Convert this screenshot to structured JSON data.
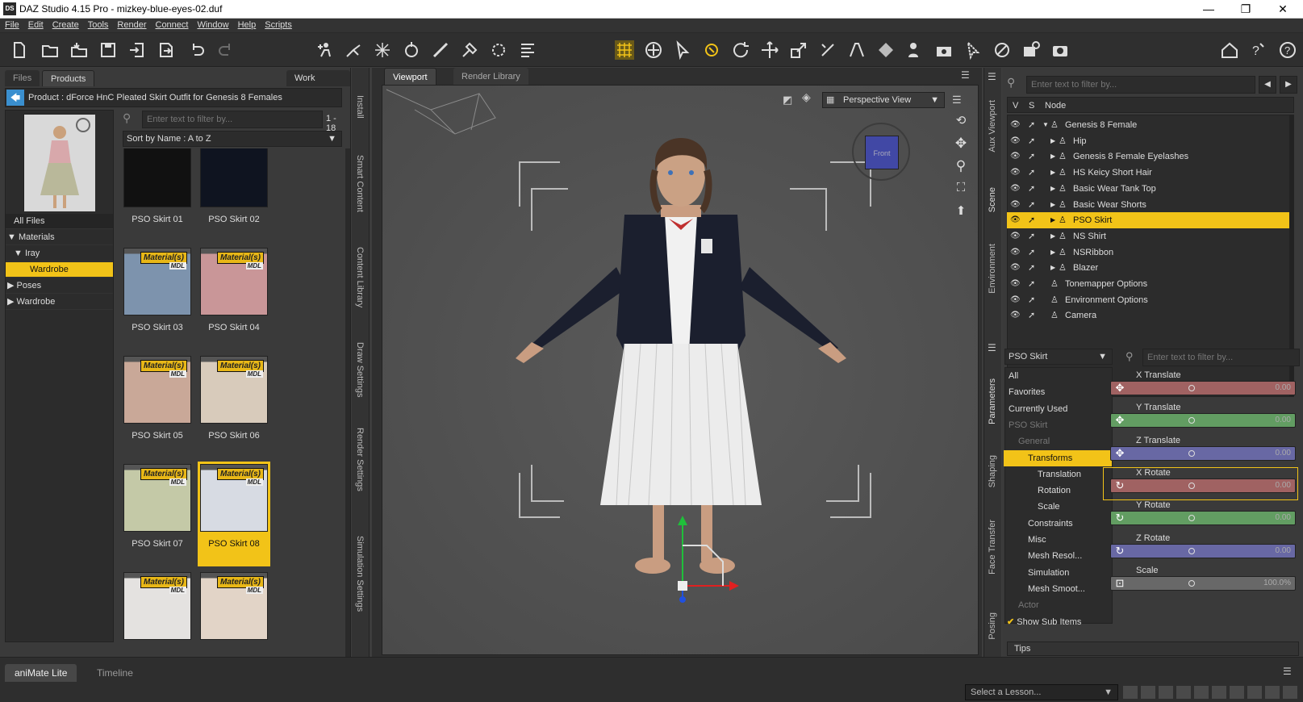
{
  "window": {
    "title": "DAZ Studio 4.15 Pro - mizkey-blue-eyes-02.duf",
    "logo": "DS",
    "controls": [
      "—",
      "❐",
      "✕"
    ]
  },
  "menu": [
    "File",
    "Edit",
    "Create",
    "Tools",
    "Render",
    "Connect",
    "Window",
    "Help",
    "Scripts"
  ],
  "left": {
    "tabs": {
      "files": "Files",
      "products": "Products",
      "work_offline": "Work Offline"
    },
    "breadcrumb": "Product : dForce HnC Pleated Skirt Outfit for Genesis 8 Females",
    "tree": {
      "all_files": "All Files",
      "materials": "Materials",
      "iray": "Iray",
      "wardrobe_sel": "Wardrobe",
      "poses": "Poses",
      "wardrobe": "Wardrobe"
    },
    "filter_placeholder": "Enter text to filter by...",
    "count": "1 - 18",
    "sort": "Sort by Name : A to Z",
    "badge": "Material(s)",
    "mdl": "MDL",
    "items": [
      {
        "label": "PSO Skirt 01",
        "color": "#111111"
      },
      {
        "label": "PSO Skirt 02",
        "color": "#0f1420"
      },
      {
        "label": "PSO Skirt 03",
        "color": "#7d93ad"
      },
      {
        "label": "PSO Skirt 04",
        "color": "#c99698"
      },
      {
        "label": "PSO Skirt 05",
        "color": "#c9a898"
      },
      {
        "label": "PSO Skirt 06",
        "color": "#d8cbbb"
      },
      {
        "label": "PSO Skirt 07",
        "color": "#c4c9a7"
      },
      {
        "label": "PSO Skirt 08",
        "color": "#d7dbe3"
      },
      {
        "label": "",
        "color": "#e4e2e0"
      },
      {
        "label": "",
        "color": "#e2d4c7"
      }
    ],
    "side_tabs": [
      "Install",
      "Smart Content",
      "Content Library",
      "Draw Settings",
      "Render Settings",
      "Simulation Settings"
    ]
  },
  "viewport": {
    "tabs": {
      "viewport": "Viewport",
      "render_library": "Render Library"
    },
    "view": "Perspective View",
    "cube": "Front"
  },
  "scene": {
    "filter_placeholder": "Enter text to filter by...",
    "headers": {
      "v": "V",
      "s": "S",
      "node": "Node"
    },
    "nodes": [
      {
        "label": "Genesis 8 Female",
        "indent": 0,
        "expander": "▼"
      },
      {
        "label": "Hip",
        "indent": 1,
        "expander": "▶"
      },
      {
        "label": "Genesis 8 Female Eyelashes",
        "indent": 1,
        "expander": "▶"
      },
      {
        "label": "HS Keicy Short Hair",
        "indent": 1,
        "expander": "▶"
      },
      {
        "label": "Basic Wear Tank Top",
        "indent": 1,
        "expander": "▶"
      },
      {
        "label": "Basic Wear Shorts",
        "indent": 1,
        "expander": "▶"
      },
      {
        "label": "PSO Skirt",
        "indent": 1,
        "expander": "▶",
        "selected": true
      },
      {
        "label": "NS Shirt",
        "indent": 1,
        "expander": "▶"
      },
      {
        "label": "NSRibbon",
        "indent": 1,
        "expander": "▶"
      },
      {
        "label": "Blazer",
        "indent": 1,
        "expander": "▶"
      },
      {
        "label": "Tonemapper Options",
        "indent": 0,
        "expander": ""
      },
      {
        "label": "Environment Options",
        "indent": 0,
        "expander": ""
      },
      {
        "label": "Camera",
        "indent": 0,
        "expander": ""
      }
    ],
    "side_tabs": [
      "Aux Viewport",
      "Scene",
      "Environment"
    ]
  },
  "params": {
    "node_select": "PSO Skirt",
    "filter_placeholder": "Enter text to filter by...",
    "categories": [
      {
        "label": "All",
        "indent": 0
      },
      {
        "label": "Favorites",
        "indent": 0
      },
      {
        "label": "Currently Used",
        "indent": 0
      },
      {
        "label": "PSO Skirt",
        "indent": 0,
        "dim": true
      },
      {
        "label": "General",
        "indent": 1,
        "dim": true
      },
      {
        "label": "Transforms",
        "indent": 2,
        "selected": true
      },
      {
        "label": "Translation",
        "indent": 3
      },
      {
        "label": "Rotation",
        "indent": 3
      },
      {
        "label": "Scale",
        "indent": 3
      },
      {
        "label": "Constraints",
        "indent": 2
      },
      {
        "label": "Misc",
        "indent": 2
      },
      {
        "label": "Mesh Resol...",
        "indent": 2
      },
      {
        "label": "Simulation",
        "indent": 2
      },
      {
        "label": "Mesh Smoot...",
        "indent": 2
      },
      {
        "label": "Actor",
        "indent": 1,
        "dim": true
      }
    ],
    "show_sub_items": "Show Sub Items",
    "sliders": [
      {
        "name": "X Translate",
        "value": "0.00",
        "color": "#a06262"
      },
      {
        "name": "Y Translate",
        "value": "0.00",
        "color": "#629d62"
      },
      {
        "name": "Z Translate",
        "value": "0.00",
        "color": "#6868a4"
      },
      {
        "name": "X Rotate",
        "value": "0.00",
        "color": "#a06262"
      },
      {
        "name": "Y Rotate",
        "value": "0.00",
        "color": "#629d62"
      },
      {
        "name": "Z Rotate",
        "value": "0.00",
        "color": "#6868a4"
      },
      {
        "name": "Scale",
        "value": "100.0%",
        "color": "#686868"
      }
    ],
    "side_tabs": [
      "Parameters",
      "Shaping",
      "Face Transfer",
      "Posing"
    ],
    "tips": "Tips"
  },
  "bottom": {
    "tabs": {
      "animate": "aniMate Lite",
      "timeline": "Timeline"
    },
    "lesson": "Select a Lesson..."
  },
  "colors": {
    "accent": "#f2c318",
    "selection_blue": "#3a8fcf"
  }
}
